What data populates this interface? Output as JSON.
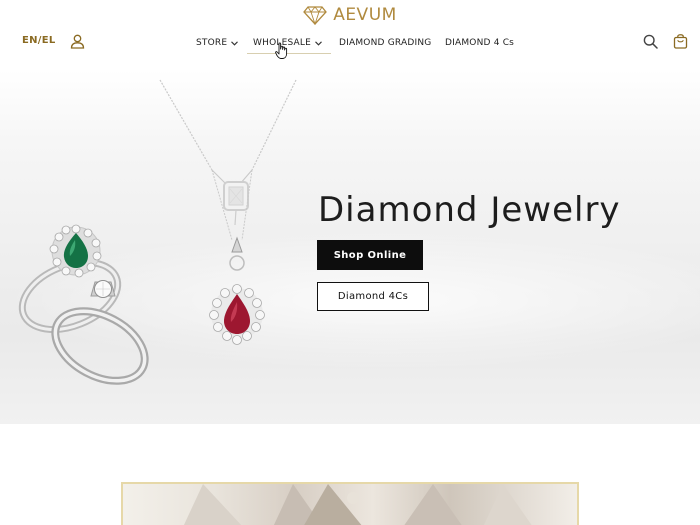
{
  "header": {
    "brand": "AEVUM",
    "language": "EN/EL",
    "nav": [
      {
        "label": "STORE",
        "has_dropdown": true
      },
      {
        "label": "WHOLESALE",
        "has_dropdown": true
      },
      {
        "label": "DIAMOND GRADING",
        "has_dropdown": false
      },
      {
        "label": "DIAMOND 4 Cs",
        "has_dropdown": false
      }
    ],
    "icons": [
      "diamond-logo-icon",
      "user-icon",
      "search-icon",
      "shopping-bag-icon",
      "chevron-down-icon",
      "hand-pointer-cursor-icon"
    ],
    "brand_color": "#b08a3e"
  },
  "hero": {
    "title": "Diamond Jewelry",
    "primary_button": "Shop Online",
    "secondary_button": "Diamond 4Cs",
    "images": [
      "emerald-diamond-ring",
      "diamond-solitaire-ring",
      "diamond-pendant-necklace",
      "ruby-pendant-necklace"
    ]
  }
}
